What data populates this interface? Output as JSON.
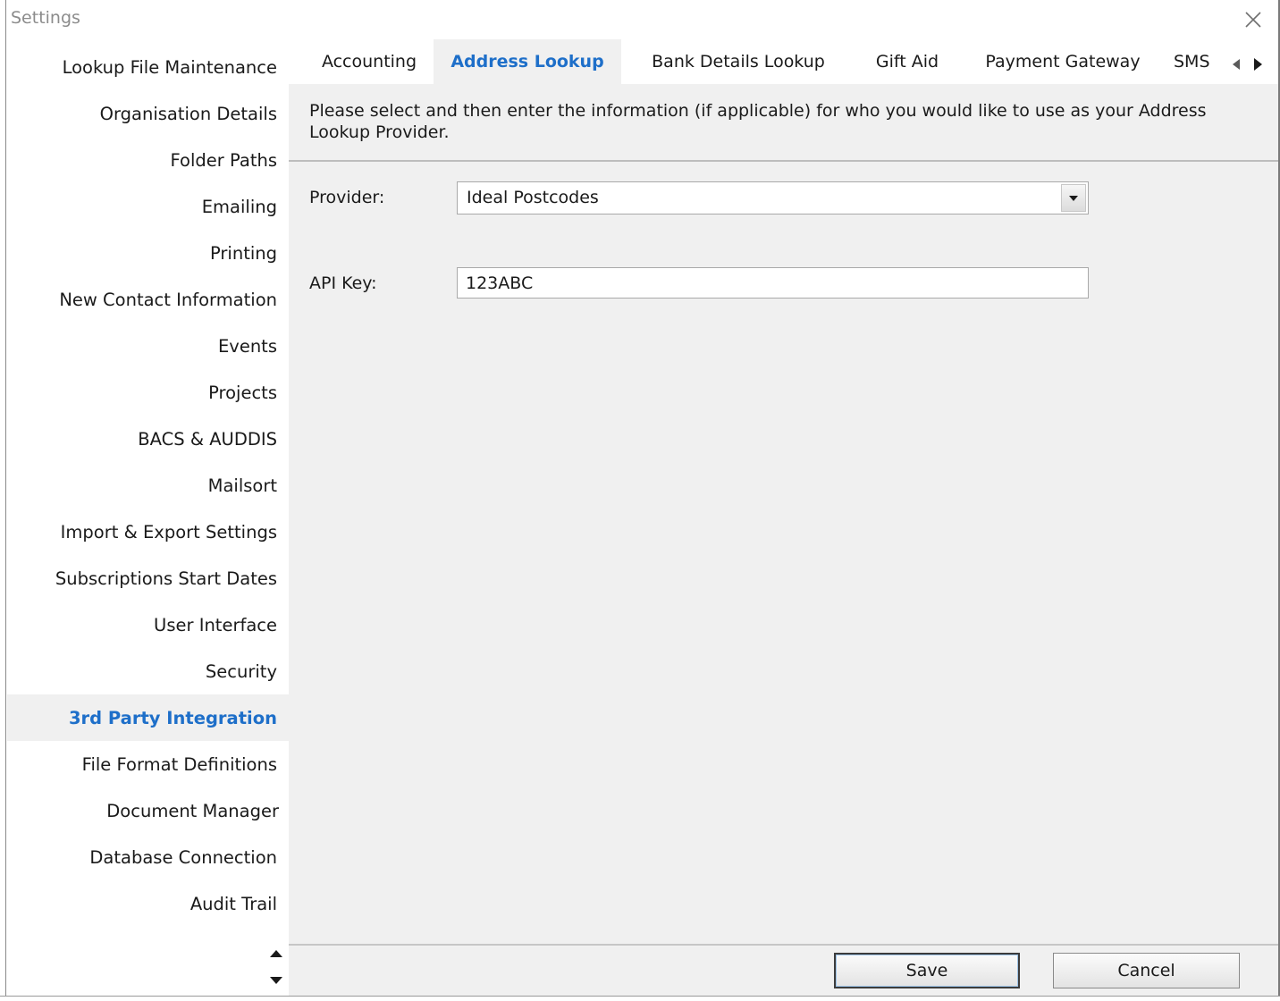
{
  "window": {
    "title": "Settings"
  },
  "sidebar": {
    "items": [
      {
        "label": "Lookup File Maintenance",
        "active": false
      },
      {
        "label": "Organisation Details",
        "active": false
      },
      {
        "label": "Folder Paths",
        "active": false
      },
      {
        "label": "Emailing",
        "active": false
      },
      {
        "label": "Printing",
        "active": false
      },
      {
        "label": "New Contact Information",
        "active": false
      },
      {
        "label": "Events",
        "active": false
      },
      {
        "label": "Projects",
        "active": false
      },
      {
        "label": "BACS & AUDDIS",
        "active": false
      },
      {
        "label": "Mailsort",
        "active": false
      },
      {
        "label": "Import & Export Settings",
        "active": false
      },
      {
        "label": "Subscriptions Start Dates",
        "active": false
      },
      {
        "label": "User Interface",
        "active": false
      },
      {
        "label": "Security",
        "active": false
      },
      {
        "label": "3rd Party Integration",
        "active": true
      },
      {
        "label": "File Format Definitions",
        "active": false
      },
      {
        "label": "Document Manager",
        "active": false
      },
      {
        "label": "Database Connection",
        "active": false
      },
      {
        "label": "Audit Trail",
        "active": false
      }
    ]
  },
  "tabs": [
    {
      "label": "Accounting",
      "active": false
    },
    {
      "label": "Address Lookup",
      "active": true
    },
    {
      "label": "Bank Details Lookup",
      "active": false
    },
    {
      "label": "Gift Aid",
      "active": false
    },
    {
      "label": "Payment Gateway",
      "active": false
    },
    {
      "label": "SMS",
      "active": false
    }
  ],
  "panel": {
    "description": "Please select and then enter the information (if applicable) for who you would like to use as your Address Lookup Provider.",
    "provider_label": "Provider:",
    "provider_value": "Ideal Postcodes",
    "api_key_label": "API Key:",
    "api_key_value": "123ABC"
  },
  "buttons": {
    "save": "Save",
    "cancel": "Cancel"
  },
  "colors": {
    "accent": "#1e6fc9",
    "panel_bg": "#f0f0f0",
    "active_sidebar_bg": "#f0f0f0"
  },
  "icons": {
    "close": "close-icon",
    "dropdown": "dropdown-arrow-icon",
    "tab_scroll_left": "triangle-left-icon",
    "tab_scroll_right": "triangle-right-icon",
    "sidebar_scroll_up": "triangle-up-icon",
    "sidebar_scroll_down": "triangle-down-icon"
  }
}
